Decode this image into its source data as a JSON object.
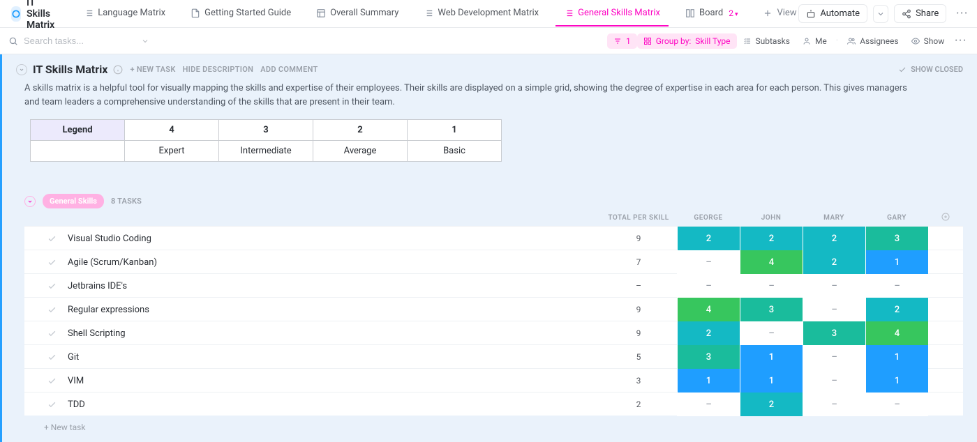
{
  "space": {
    "title": "IT Skills Matrix"
  },
  "tabs": {
    "language": "Language Matrix",
    "guide": "Getting Started Guide",
    "overall": "Overall Summary",
    "webdev": "Web Development Matrix",
    "general": "General Skills Matrix",
    "board": "Board",
    "board_badge": "2",
    "view": "View"
  },
  "topbar": {
    "automate": "Automate",
    "share": "Share"
  },
  "search": {
    "placeholder": "Search tasks..."
  },
  "filters": {
    "count": "1",
    "group_by_label": "Group by:",
    "group_by_value": "Skill Type",
    "subtasks": "Subtasks",
    "me": "Me",
    "assignees": "Assignees",
    "show": "Show"
  },
  "list_header": {
    "title": "IT Skills Matrix",
    "new_task": "+ NEW TASK",
    "hide_desc": "HIDE DESCRIPTION",
    "add_comment": "ADD COMMENT",
    "show_closed": "SHOW CLOSED"
  },
  "description": "A skills matrix is a helpful tool for visually mapping the skills and expertise of their employees. Their skills are displayed on a simple grid, showing the degree of expertise in each area for each person. This gives managers and team leaders a comprehensive understanding of the skills that are present in their team.",
  "legend": {
    "head": "Legend",
    "cols": [
      "4",
      "3",
      "2",
      "1"
    ],
    "vals": [
      "Expert",
      "Intermediate",
      "Average",
      "Basic"
    ]
  },
  "group": {
    "label": "General Skills",
    "count": "8 TASKS"
  },
  "columns": {
    "total": "TOTAL PER SKILL",
    "people": [
      "GEORGE",
      "JOHN",
      "MARY",
      "GARY"
    ]
  },
  "skill_colors": {
    "1": "#1f9eff",
    "2": "#14b9c4",
    "3": "#1abc9c",
    "4": "#37c65e"
  },
  "rows": [
    {
      "name": "Visual Studio Coding",
      "total": "9",
      "vals": [
        "2",
        "2",
        "2",
        "3"
      ]
    },
    {
      "name": "Agile (Scrum/Kanban)",
      "total": "7",
      "vals": [
        "–",
        "4",
        "2",
        "1"
      ]
    },
    {
      "name": "Jetbrains IDE's",
      "total": "–",
      "vals": [
        "–",
        "–",
        "–",
        "–"
      ]
    },
    {
      "name": "Regular expressions",
      "total": "9",
      "vals": [
        "4",
        "3",
        "–",
        "2"
      ]
    },
    {
      "name": "Shell Scripting",
      "total": "9",
      "vals": [
        "2",
        "–",
        "3",
        "4"
      ]
    },
    {
      "name": "Git",
      "total": "5",
      "vals": [
        "3",
        "1",
        "–",
        "1"
      ]
    },
    {
      "name": "VIM",
      "total": "3",
      "vals": [
        "1",
        "1",
        "–",
        "1"
      ]
    },
    {
      "name": "TDD",
      "total": "2",
      "vals": [
        "–",
        "2",
        "–",
        "–"
      ]
    }
  ],
  "new_task_row": "+ New task"
}
